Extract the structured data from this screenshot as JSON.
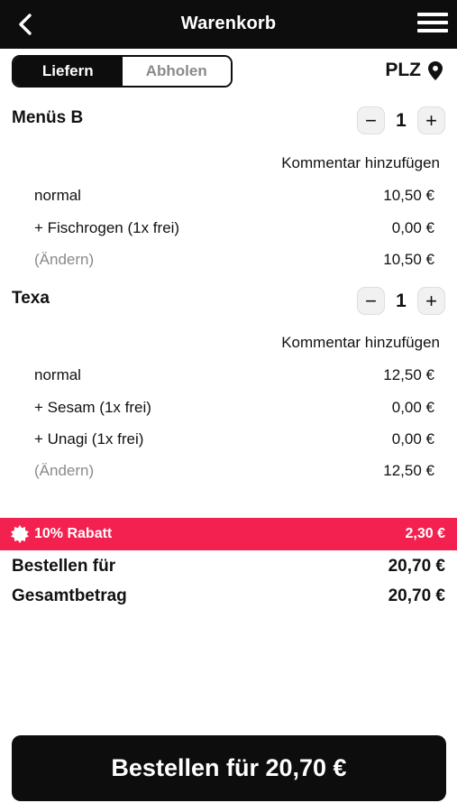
{
  "header": {
    "title": "Warenkorb",
    "back_icon": "chevron-left-icon",
    "menu_icon": "hamburger-menu-icon"
  },
  "delivery_toggle": {
    "options": [
      "Liefern",
      "Abholen"
    ],
    "selected": "Liefern"
  },
  "location": {
    "label": "PLZ",
    "icon": "map-pin-icon"
  },
  "cart": {
    "items": [
      {
        "name": "Menüs B",
        "quantity": "1",
        "comment_label": "Kommentar hinzufügen",
        "lines": [
          {
            "label": "normal",
            "price": "10,50 €"
          },
          {
            "label": "+ Fischrogen (1x frei)",
            "price": "0,00 €"
          },
          {
            "label": "(Ändern)",
            "price": "10,50 €"
          }
        ]
      },
      {
        "name": "Texa",
        "quantity": "1",
        "comment_label": "Kommentar hinzufügen",
        "lines": [
          {
            "label": "normal",
            "price": "12,50 €"
          },
          {
            "label": "+ Sesam (1x frei)",
            "price": "0,00 €"
          },
          {
            "label": "+ Unagi (1x frei)",
            "price": "0,00 €"
          },
          {
            "label": "(Ändern)",
            "price": "12,50 €"
          }
        ]
      }
    ]
  },
  "discount": {
    "label": "10% Rabatt",
    "amount": "2,30 €",
    "icon": "badge-icon",
    "color": "#f3214f"
  },
  "totals": {
    "order_for_label": "Bestellen für",
    "order_for_value": "20,70 €",
    "total_label": "Gesamtbetrag",
    "total_value": "20,70 €"
  },
  "order_button": {
    "label": "Bestellen für 20,70 €"
  }
}
